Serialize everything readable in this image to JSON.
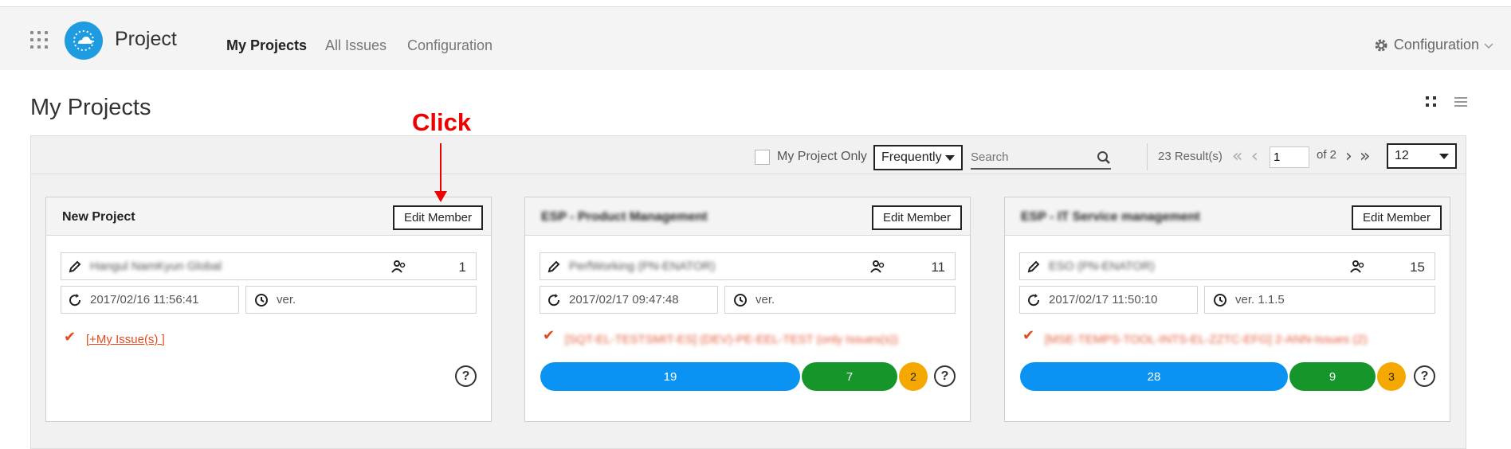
{
  "header": {
    "app_title": "Project",
    "nav": [
      "My Projects",
      "All Issues",
      "Configuration"
    ],
    "config_label": "Configuration"
  },
  "page": {
    "title": "My Projects"
  },
  "annotation": {
    "label": "Click",
    "color": "#ee0000"
  },
  "toolbar": {
    "my_project_only_label": "My Project Only",
    "sort_value": "Frequently",
    "search_placeholder": "Search",
    "results_text": "23 Result(s)",
    "page_value": "1",
    "page_of": "of 2",
    "page_size": "12"
  },
  "cards": [
    {
      "title": "New Project",
      "edit_label": "Edit Member",
      "manager": "Hangul NamKyun Global",
      "members": "1",
      "date": "2017/02/16 11:56:41",
      "version": "ver.",
      "issue_link": "[+My Issue(s) ]"
    },
    {
      "title": "ESP - Product Management",
      "edit_label": "Edit Member",
      "manager": "PerfWorking (PN-ENATOR)",
      "members": "11",
      "date": "2017/02/17 09:47:48",
      "version": "ver.",
      "issue_text": "[SQT-EL-TESTSMIT-ES] (DEV)-PE-EEL-TEST (only Issues(s))",
      "counts": {
        "blue": "19",
        "green": "7",
        "orange": "2"
      }
    },
    {
      "title": "ESP - IT Service management",
      "edit_label": "Edit Member",
      "manager": "ESO (PN-ENATOR)",
      "members": "15",
      "date": "2017/02/17 11:50:10",
      "version": "ver. 1.1.5",
      "issue_text": "[MSE-TEMPS-TOOL-INTS-EL-ZZTC-EFG] 2-ANN-Issues (2)",
      "counts": {
        "blue": "28",
        "green": "9",
        "orange": "3"
      }
    }
  ],
  "colors": {
    "accent": "#1f9be0",
    "pill_blue": "#0a93f2",
    "pill_green": "#15952a",
    "pill_orange": "#f5a800",
    "issue_red": "#e34b1e"
  },
  "icons": [
    "apps-grid-icon",
    "cloud-logo-icon",
    "gear-icon",
    "grid-view-icon",
    "list-view-icon",
    "search-icon",
    "pencil-icon",
    "members-icon",
    "refresh-icon",
    "clock-icon",
    "checkmark-icon",
    "help-icon"
  ]
}
